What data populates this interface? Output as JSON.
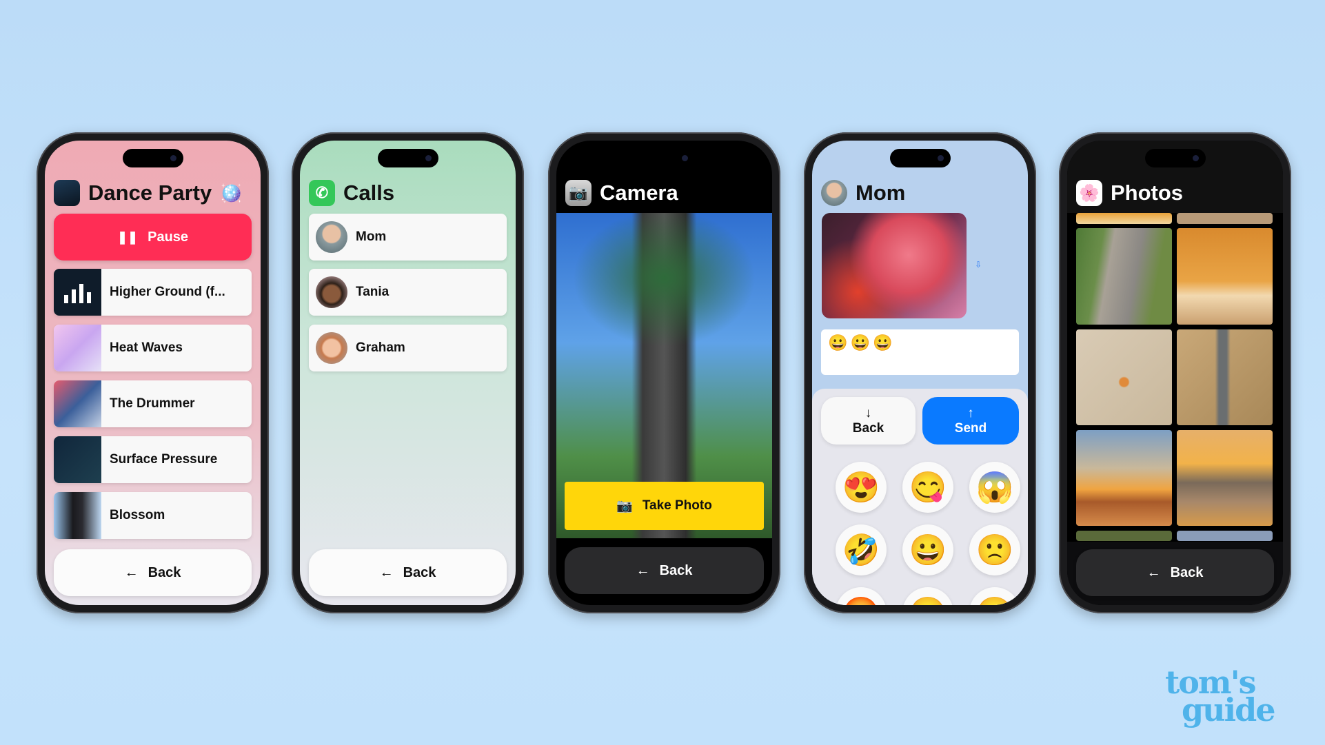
{
  "music": {
    "title": "Dance Party",
    "title_emoji": "🪩",
    "pause_label": "Pause",
    "back_label": "Back",
    "songs": [
      {
        "title": "Higher Ground (f..."
      },
      {
        "title": "Heat Waves"
      },
      {
        "title": "The Drummer"
      },
      {
        "title": "Surface Pressure"
      },
      {
        "title": "Blossom"
      }
    ],
    "accent": "#ff2d55"
  },
  "calls": {
    "title": "Calls",
    "back_label": "Back",
    "contacts": [
      {
        "name": "Mom"
      },
      {
        "name": "Tania"
      },
      {
        "name": "Graham"
      }
    ]
  },
  "camera": {
    "title": "Camera",
    "take_photo_label": "Take Photo",
    "back_label": "Back",
    "accent": "#ffd60a"
  },
  "messages": {
    "title": "Mom",
    "draft": "😀😀😀",
    "back_label": "Back",
    "send_label": "Send",
    "send_color": "#0a7aff",
    "emojis": [
      "😍",
      "😋",
      "😱",
      "🤣",
      "😀",
      "🙁",
      "😡",
      "😀",
      "😀"
    ]
  },
  "photos": {
    "title": "Photos",
    "back_label": "Back"
  },
  "watermark": {
    "line1": "tom's",
    "line2": "guide"
  }
}
